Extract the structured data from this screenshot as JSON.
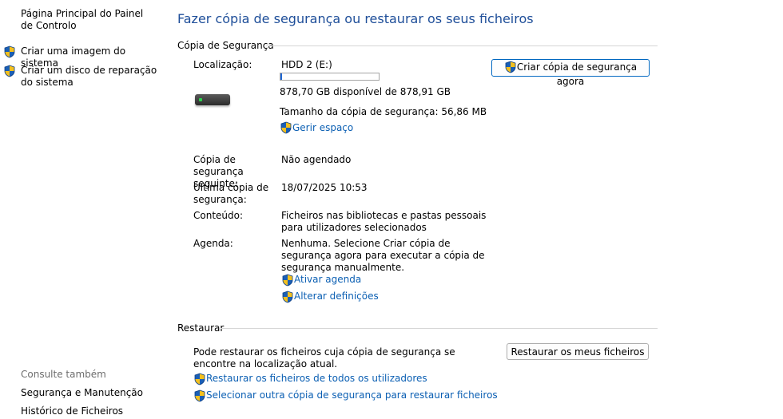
{
  "sidebar": {
    "home_label": "Página Principal do Painel de Controlo",
    "tasks": [
      {
        "label": "Criar uma imagem do sistema",
        "icon": "uac-shield-icon"
      },
      {
        "label": "Criar um disco de reparação do sistema",
        "icon": "uac-shield-icon"
      }
    ],
    "see_also_title": "Consulte também",
    "see_also": [
      {
        "label": "Segurança e Manutenção"
      },
      {
        "label": "Histórico de Ficheiros"
      }
    ]
  },
  "main": {
    "title": "Fazer cópia de segurança ou restaurar os seus ficheiros",
    "backup_section": {
      "heading": "Cópia de Segurança",
      "location_label": "Localização:",
      "location_value": "HDD 2 (E:)",
      "drive_icon": "hard-drive-icon",
      "free_space_text": "878,70 GB disponível de 878,91 GB",
      "used_fraction": 0.0002,
      "backup_size_text": "Tamanho da cópia de segurança: 56,86 MB",
      "manage_space_link": "Gerir espaço",
      "create_backup_button": "Criar cópia de segurança agora",
      "next_backup_label": "Cópia de segurança seguinte:",
      "next_backup_value": "Não agendado",
      "last_backup_label": "Última cópia de segurança:",
      "last_backup_value": "18/07/2025 10:53",
      "contents_label": "Conteúdo:",
      "contents_value": "Ficheiros nas bibliotecas e pastas pessoais para utilizadores selecionados",
      "schedule_label": "Agenda:",
      "schedule_value": "Nenhuma. Selecione Criar cópia de segurança agora para executar a cópia de segurança manualmente.",
      "turn_on_schedule_link": "Ativar agenda",
      "change_settings_link": "Alterar definições"
    },
    "restore_section": {
      "heading": "Restaurar",
      "description": "Pode restaurar os ficheiros cuja cópia de segurança se encontre na localização atual.",
      "restore_my_files_button": "Restaurar os meus ficheiros",
      "restore_all_users_link": "Restaurar os ficheiros de todos os utilizadores",
      "select_other_backup_link": "Selecionar outra cópia de segurança para restaurar ficheiros"
    }
  },
  "colors": {
    "title": "#1e4e99",
    "link": "#0b5fb3",
    "progress_fill": "#1f68d6",
    "divider": "#d6d6d6"
  }
}
